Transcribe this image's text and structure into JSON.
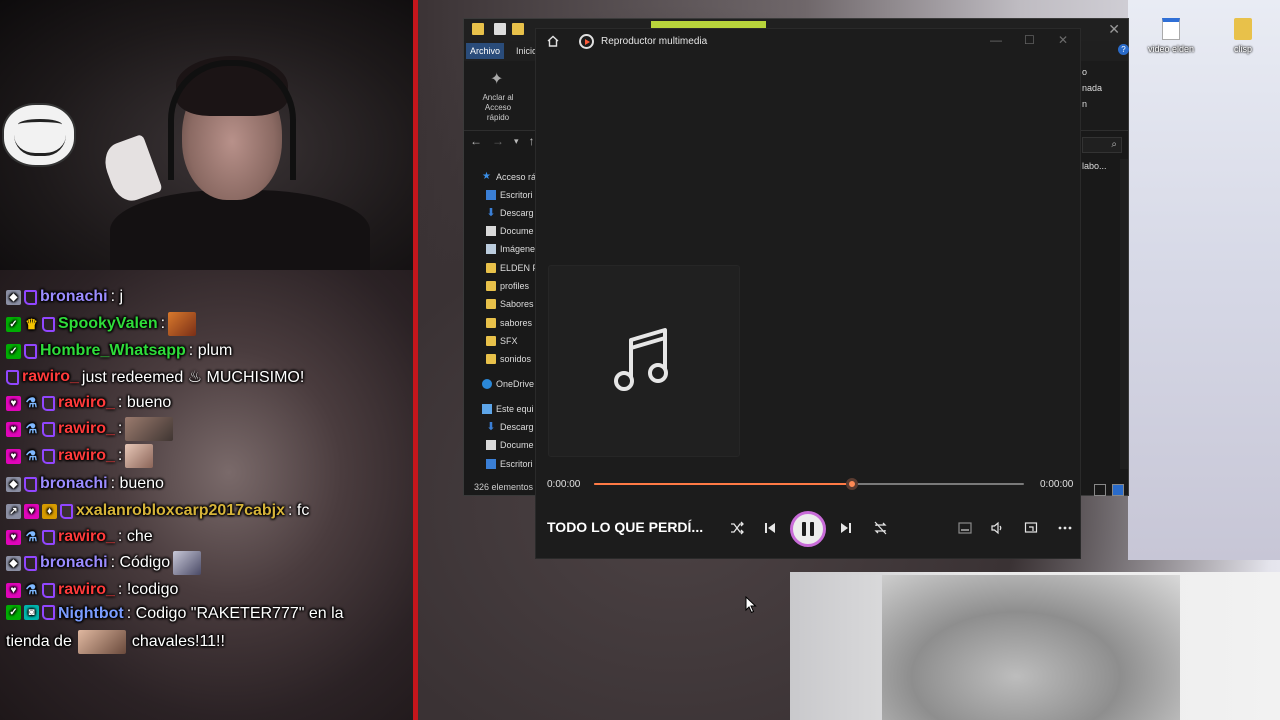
{
  "chat": {
    "lines": [
      {
        "user": "bronachi",
        "user_color": "#9b8cff",
        "text": ": j"
      },
      {
        "user": "SpookyValen",
        "user_color": "#2fdc3a",
        "text": ":"
      },
      {
        "user": "Hombre_Whatsapp",
        "user_color": "#2fdc3a",
        "text": ": plum"
      },
      {
        "user": "rawiro_",
        "user_color": "#ff3b3b",
        "text": " just redeemed ♨ MUCHISIMO!"
      },
      {
        "user": "rawiro_",
        "user_color": "#ff3b3b",
        "text": ": bueno"
      },
      {
        "user": "rawiro_",
        "user_color": "#ff3b3b",
        "text": ":"
      },
      {
        "user": "rawiro_",
        "user_color": "#ff3b3b",
        "text": ":"
      },
      {
        "user": "bronachi",
        "user_color": "#9b8cff",
        "text": ": bueno"
      },
      {
        "user": "xxalanrobloxcarp2017cabjx",
        "user_color": "#d6b43a",
        "text": ": fc"
      },
      {
        "user": "rawiro_",
        "user_color": "#ff3b3b",
        "text": ": che"
      },
      {
        "user": "bronachi",
        "user_color": "#9b8cff",
        "text": ": Código"
      },
      {
        "user": "rawiro_",
        "user_color": "#ff3b3b",
        "text": ": !codigo"
      },
      {
        "user": "Nightbot",
        "user_color": "#7a9cff",
        "text": ": Codigo \"RAKETER777\" en la",
        "text2": "tienda de",
        "text3": "chavales!11!!"
      }
    ]
  },
  "explorer": {
    "tabs": {
      "archivo": "Archivo",
      "inicio": "Inicio"
    },
    "ribbon": {
      "pin_label": "Anclar al Acceso rápido"
    },
    "sidebar": [
      {
        "label": "Acceso rá",
        "icon": "star-icon"
      },
      {
        "label": "Escritori",
        "icon": "desktop-icon"
      },
      {
        "label": "Descarg",
        "icon": "download-icon"
      },
      {
        "label": "Docume",
        "icon": "document-icon"
      },
      {
        "label": "Imágene",
        "icon": "image-icon"
      },
      {
        "label": "ELDEN F",
        "icon": "folder-icon"
      },
      {
        "label": "profiles",
        "icon": "folder-icon"
      },
      {
        "label": "Sabores",
        "icon": "folder-icon"
      },
      {
        "label": "sabores",
        "icon": "folder-icon"
      },
      {
        "label": "SFX",
        "icon": "folder-icon"
      },
      {
        "label": "sonidos",
        "icon": "folder-icon"
      },
      {
        "label": "OneDrive",
        "icon": "cloud-icon"
      },
      {
        "label": "Este equi",
        "icon": "pc-icon"
      },
      {
        "label": "Descarg",
        "icon": "download-icon"
      },
      {
        "label": "Docume",
        "icon": "document-icon"
      },
      {
        "label": "Escritori",
        "icon": "desktop-icon"
      }
    ],
    "status": "326 elementos",
    "right_fragments": [
      "o",
      "nada",
      "n",
      "labo..."
    ]
  },
  "desktop": {
    "icons": [
      {
        "label": "video elden"
      },
      {
        "label": "clisp"
      }
    ]
  },
  "player": {
    "title": "Reproductor multimedia",
    "time_current": "0:00:00",
    "time_total": "0:00:00",
    "progress": 0.6,
    "song_title": "TODO LO QUE PERDÍ...",
    "accent": "#ff7a45"
  }
}
